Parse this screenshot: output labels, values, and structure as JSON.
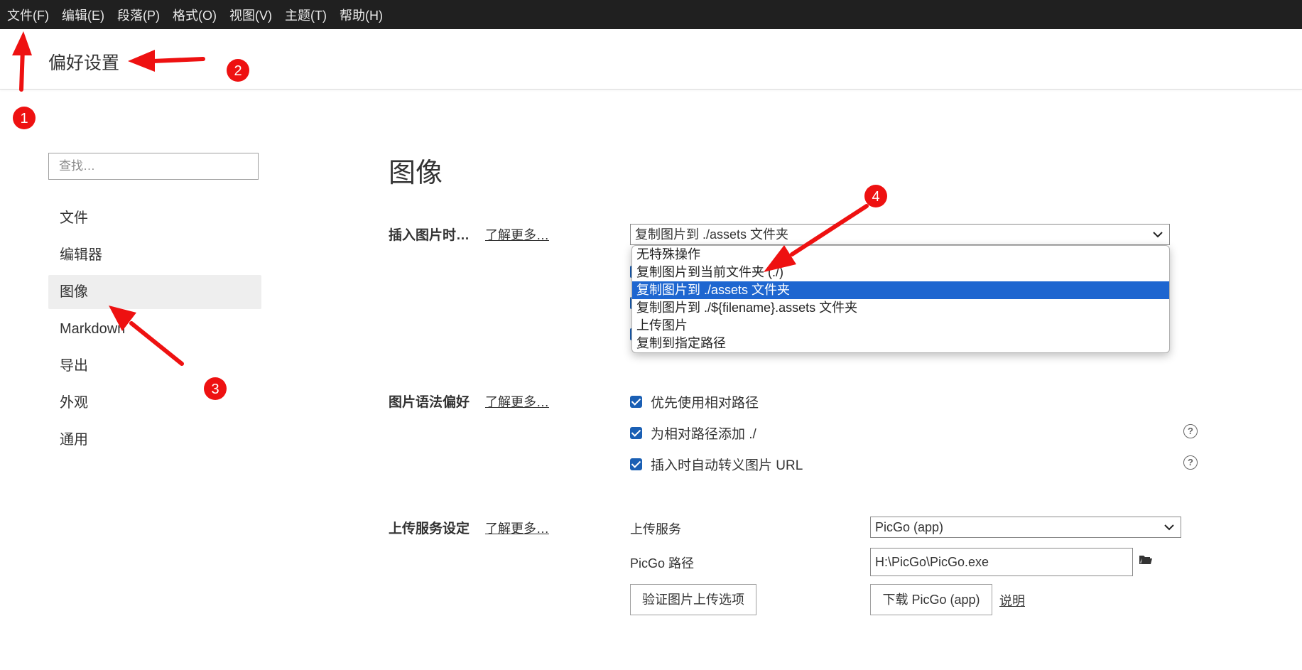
{
  "menubar": {
    "items": [
      "文件(F)",
      "编辑(E)",
      "段落(P)",
      "格式(O)",
      "视图(V)",
      "主题(T)",
      "帮助(H)"
    ]
  },
  "page_title": "偏好设置",
  "search": {
    "placeholder": "查找…"
  },
  "sidebar": {
    "items": [
      {
        "label": "文件"
      },
      {
        "label": "编辑器"
      },
      {
        "label": "图像",
        "active": true
      },
      {
        "label": "Markdown"
      },
      {
        "label": "导出"
      },
      {
        "label": "外观"
      },
      {
        "label": "通用"
      }
    ]
  },
  "section": {
    "title": "图像"
  },
  "insert_image": {
    "label": "插入图片时…",
    "learn_more": "了解更多…",
    "selected": "复制图片到 ./assets 文件夹",
    "options": [
      "无特殊操作",
      "复制图片到当前文件夹 (./)",
      "复制图片到 ./assets 文件夹",
      "复制图片到 ./${filename}.assets 文件夹",
      "上传图片",
      "复制到指定路径"
    ],
    "selected_index": 2
  },
  "image_syntax": {
    "label": "图片语法偏好",
    "learn_more": "了解更多…",
    "checkboxes": [
      {
        "label": "优先使用相对路径",
        "checked": true
      },
      {
        "label": "为相对路径添加 ./",
        "checked": true
      },
      {
        "label": "插入时自动转义图片 URL",
        "checked": true
      }
    ]
  },
  "upload": {
    "label": "上传服务设定",
    "learn_more": "了解更多…",
    "service_label": "上传服务",
    "service_value": "PicGo (app)",
    "path_label": "PicGo 路径",
    "path_value": "H:\\PicGo\\PicGo.exe",
    "verify_button": "验证图片上传选项",
    "download_button": "下载 PicGo (app)",
    "explain_link": "说明"
  },
  "annotations": {
    "badges": [
      "1",
      "2",
      "3",
      "4"
    ],
    "color": "#ee1111"
  },
  "colors": {
    "menubar_bg": "#202020",
    "selection_blue": "#1e66d0",
    "checkbox_blue": "#1a5fb4"
  }
}
